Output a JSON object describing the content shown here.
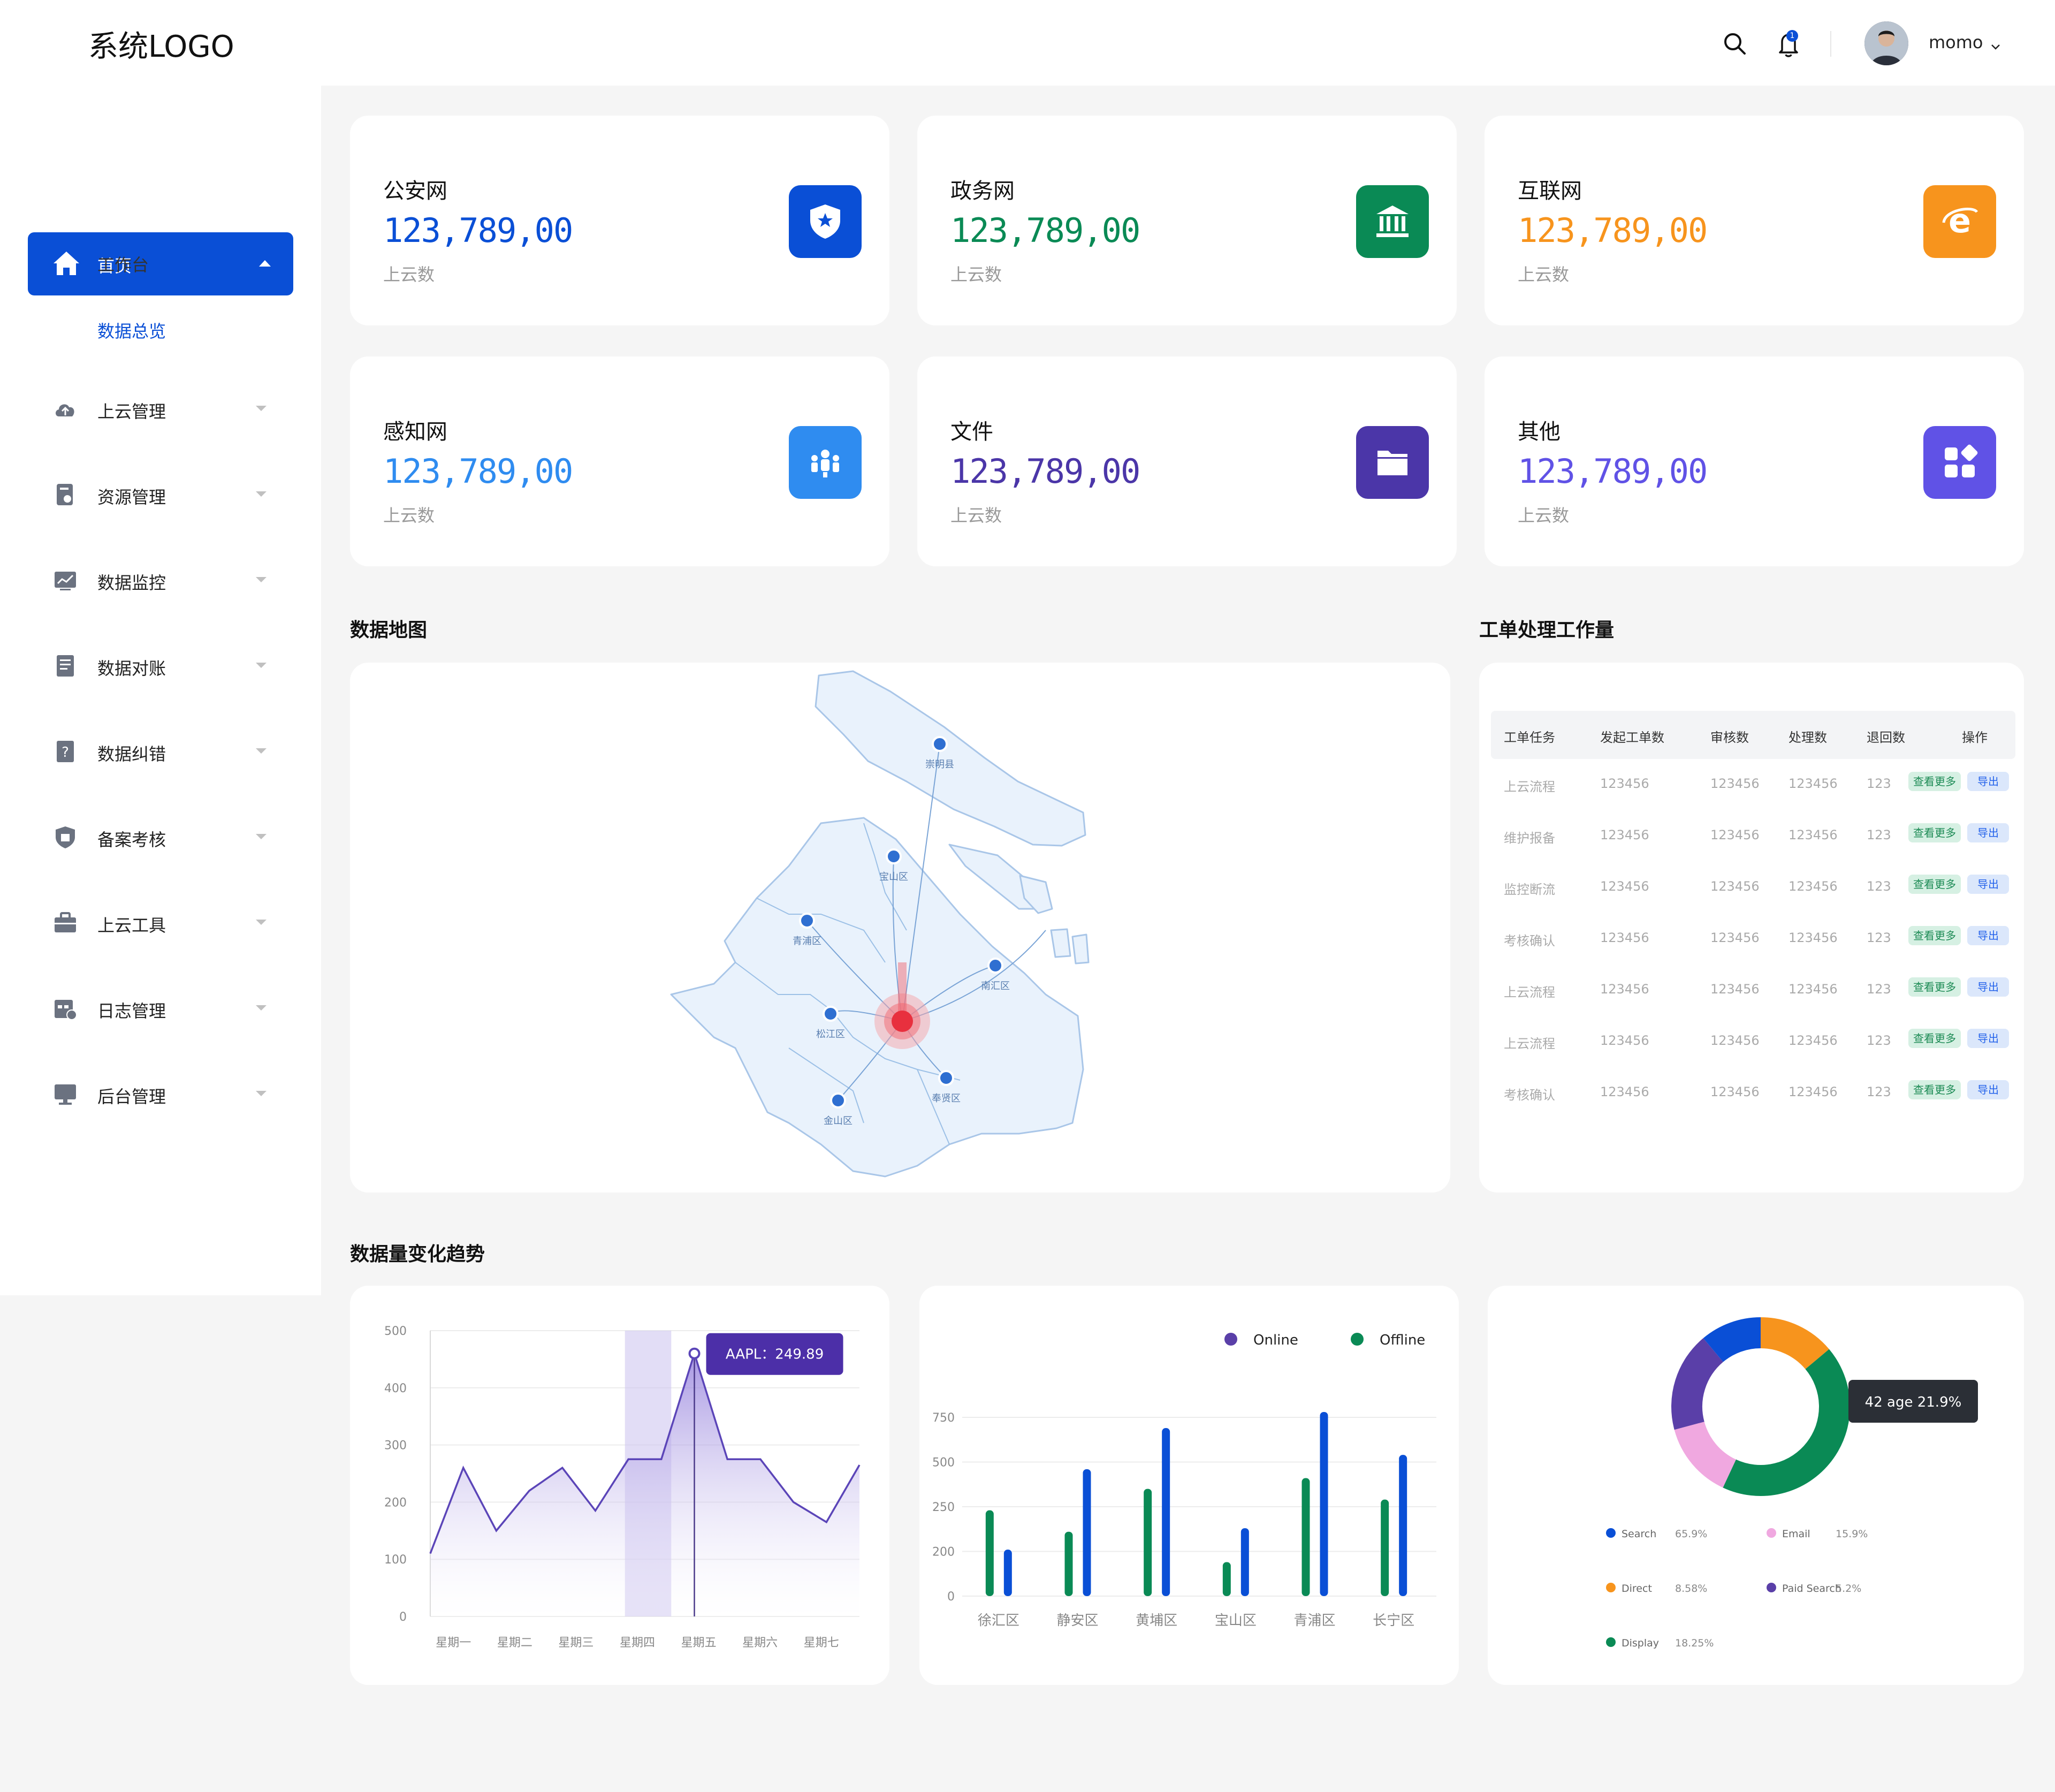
{
  "header": {
    "logo": "系统LOGO",
    "username": "momo",
    "notification_count": "1"
  },
  "sidebar": {
    "home_label": "首页",
    "sub_items": [
      "工作台",
      "数据总览"
    ],
    "items": [
      "上云管理",
      "资源管理",
      "数据监控",
      "数据对账",
      "数据纠错",
      "备案考核",
      "上云工具",
      "日志管理",
      "后台管理"
    ]
  },
  "stats": [
    {
      "title": "公安网",
      "value": "123,789,00",
      "sub": "上云数",
      "color": "#0a4fd6",
      "icon": "police-badge-icon"
    },
    {
      "title": "政务网",
      "value": "123,789,00",
      "sub": "上云数",
      "color": "#0a8a55",
      "icon": "government-building-icon"
    },
    {
      "title": "互联网",
      "value": "123,789,00",
      "sub": "上云数",
      "color": "#f7941d",
      "icon": "ie-browser-icon"
    },
    {
      "title": "感知网",
      "value": "123,789,00",
      "sub": "上云数",
      "color": "#2f8cf0",
      "icon": "people-network-icon"
    },
    {
      "title": "文件",
      "value": "123,789,00",
      "sub": "上云数",
      "color": "#4b36a8",
      "icon": "folder-icon"
    },
    {
      "title": "其他",
      "value": "123,789,00",
      "sub": "上云数",
      "color": "#6052e6",
      "icon": "apps-grid-icon"
    }
  ],
  "map": {
    "title": "数据地图",
    "districts": [
      "崇明县",
      "宝山区",
      "青浦区",
      "南汇区",
      "松江区",
      "奉贤区",
      "金山区"
    ]
  },
  "workload": {
    "title": "工单处理工作量",
    "headers": [
      "工单任务",
      "发起工单数",
      "审核数",
      "处理数",
      "退回数",
      "操作"
    ],
    "rows": [
      [
        "上云流程",
        "123456",
        "123456",
        "123456",
        "123"
      ],
      [
        "维护报备",
        "123456",
        "123456",
        "123456",
        "123"
      ],
      [
        "监控断流",
        "123456",
        "123456",
        "123456",
        "123"
      ],
      [
        "考核确认",
        "123456",
        "123456",
        "123456",
        "123"
      ],
      [
        "上云流程",
        "123456",
        "123456",
        "123456",
        "123"
      ],
      [
        "上云流程",
        "123456",
        "123456",
        "123456",
        "123"
      ],
      [
        "考核确认",
        "123456",
        "123456",
        "123456",
        "123"
      ]
    ],
    "more_label": "查看更多",
    "export_label": "导出"
  },
  "trend": {
    "title": "数据量变化趋势"
  },
  "chart_data": [
    {
      "type": "area",
      "categories": [
        "星期一",
        "星期二",
        "星期三",
        "星期四",
        "星期五",
        "星期六",
        "星期七"
      ],
      "x": [
        0,
        0.5,
        1,
        1.5,
        2,
        2.5,
        3,
        3.5,
        4,
        4.5,
        5,
        5.5,
        6,
        6.5
      ],
      "values": [
        110,
        260,
        150,
        220,
        260,
        185,
        275,
        275,
        460,
        275,
        275,
        200,
        165,
        265
      ],
      "ylim": [
        0,
        500
      ],
      "yticks": [
        0,
        100,
        200,
        300,
        400,
        500
      ],
      "highlight_category": "星期四",
      "tooltip": "AAPL：249.89",
      "color": "#5b45b8"
    },
    {
      "type": "bar",
      "categories": [
        "徐汇区",
        "静安区",
        "黄埔区",
        "宝山区",
        "青浦区",
        "长宁区"
      ],
      "ytick_labels": [
        "0",
        "200",
        "250",
        "500",
        "750"
      ],
      "series": [
        {
          "name": "Online",
          "color": "#0a4fd6",
          "values": [
            0.26,
            0.71,
            0.94,
            0.38,
            1.03,
            0.79
          ]
        },
        {
          "name": "Offline",
          "color": "#0a8a55",
          "values": [
            0.48,
            0.36,
            0.6,
            0.19,
            0.66,
            0.54
          ]
        }
      ]
    },
    {
      "type": "pie",
      "slices": [
        {
          "label": "Search",
          "value": 65.9,
          "color": "#0a4fd6"
        },
        {
          "label": "Email",
          "value": 15.9,
          "color": "#f0a8e0"
        },
        {
          "label": "Direct",
          "value": 8.58,
          "color": "#f7941d"
        },
        {
          "label": "Paid Search",
          "value": 5.2,
          "color": "#5a3fa8"
        },
        {
          "label": "Display",
          "value": 18.25,
          "color": "#0a8a55"
        }
      ],
      "legend": [
        "Search",
        "65.9%",
        "Email",
        "15.9%",
        "Direct",
        "8.58%",
        "Paid Search",
        "5.2%",
        "Display",
        "18.25%"
      ],
      "tooltip": "42 age 21.9%"
    }
  ]
}
